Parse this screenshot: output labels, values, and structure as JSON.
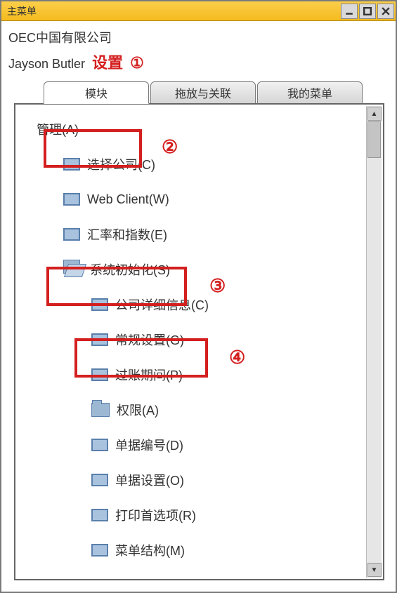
{
  "window": {
    "title": "主菜单"
  },
  "header": {
    "company": "OEC中国有限公司",
    "user": "Jayson Butler",
    "settings_label": "设置",
    "callout1": "①"
  },
  "tabs": [
    {
      "label": "模块",
      "selected": true
    },
    {
      "label": "拖放与关联",
      "selected": false
    },
    {
      "label": "我的菜单",
      "selected": false
    }
  ],
  "tree": {
    "root": {
      "label": "管理(A)",
      "icon": "module"
    },
    "children": [
      {
        "label": "选择公司(C)",
        "icon": "window",
        "level": 2
      },
      {
        "label": "Web Client(W)",
        "icon": "window",
        "level": 2
      },
      {
        "label": "汇率和指数(E)",
        "icon": "window",
        "level": 2
      },
      {
        "label": "系统初始化(S)",
        "icon": "folder-open",
        "level": 2,
        "children": [
          {
            "label": "公司详细信息(C)",
            "icon": "window",
            "level": 3
          },
          {
            "label": "常规设置(G)",
            "icon": "window",
            "level": 3
          },
          {
            "label": "过账期间(P)",
            "icon": "window",
            "level": 3
          },
          {
            "label": "权限(A)",
            "icon": "folder-closed",
            "level": 3
          },
          {
            "label": "单据编号(D)",
            "icon": "window",
            "level": 3
          },
          {
            "label": "单据设置(O)",
            "icon": "window",
            "level": 3
          },
          {
            "label": "打印首选项(R)",
            "icon": "window",
            "level": 3
          },
          {
            "label": "菜单结构(M)",
            "icon": "window",
            "level": 3
          }
        ]
      }
    ]
  },
  "callouts": {
    "c2": "②",
    "c3": "③",
    "c4": "④"
  }
}
